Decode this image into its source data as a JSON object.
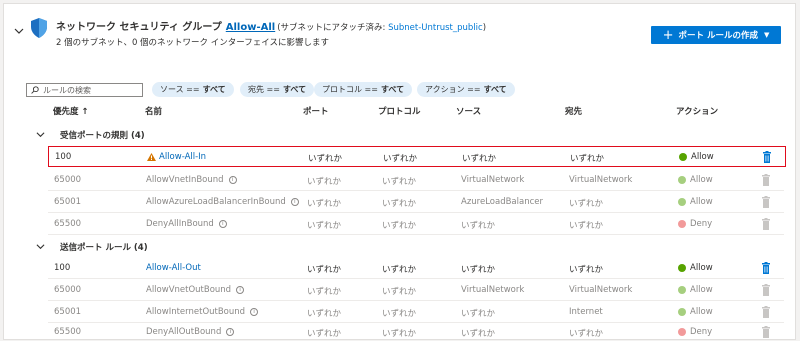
{
  "header": {
    "title": "ネットワーク セキュリティ グループ",
    "nsg_name": "Allow-All",
    "attached_prefix": "(サブネットにアタッチ済み: ",
    "attached_subnet": "Subnet-Untrust_public",
    "attached_suffix": ")",
    "subtitle": "2 個のサブネット、0 個のネットワーク インターフェイスに影響します",
    "create_button": "ポート ルールの作成"
  },
  "filters": {
    "search_placeholder": "ルールの検索",
    "pills": [
      {
        "label": "ソース ==",
        "value": "すべて"
      },
      {
        "label": "宛先 ==",
        "value": "すべて"
      },
      {
        "label": "プロトコル ==",
        "value": "すべて"
      },
      {
        "label": "アクション ==",
        "value": "すべて"
      }
    ]
  },
  "columns": {
    "priority": "優先度 ↑",
    "name": "名前",
    "port": "ポート",
    "protocol": "プロトコル",
    "source": "ソース",
    "destination": "宛先",
    "action": "アクション"
  },
  "groups": [
    {
      "label": "受信ポートの規則 (4)",
      "rows": [
        {
          "priority": "100",
          "name": "Allow-All-In",
          "port": "いずれか",
          "protocol": "いずれか",
          "source": "いずれか",
          "destination": "いずれか",
          "action": "Allow"
        },
        {
          "priority": "65000",
          "name": "AllowVnetInBound",
          "port": "いずれか",
          "protocol": "いずれか",
          "source": "VirtualNetwork",
          "destination": "VirtualNetwork",
          "action": "Allow"
        },
        {
          "priority": "65001",
          "name": "AllowAzureLoadBalancerInBound",
          "port": "いずれか",
          "protocol": "いずれか",
          "source": "AzureLoadBalancer",
          "destination": "いずれか",
          "action": "Allow"
        },
        {
          "priority": "65500",
          "name": "DenyAllInBound",
          "port": "いずれか",
          "protocol": "いずれか",
          "source": "いずれか",
          "destination": "いずれか",
          "action": "Deny"
        }
      ]
    },
    {
      "label": "送信ポート ルール (4)",
      "rows": [
        {
          "priority": "100",
          "name": "Allow-All-Out",
          "port": "いずれか",
          "protocol": "いずれか",
          "source": "いずれか",
          "destination": "いずれか",
          "action": "Allow"
        },
        {
          "priority": "65000",
          "name": "AllowVnetOutBound",
          "port": "いずれか",
          "protocol": "いずれか",
          "source": "VirtualNetwork",
          "destination": "VirtualNetwork",
          "action": "Allow"
        },
        {
          "priority": "65001",
          "name": "AllowInternetOutBound",
          "port": "いずれか",
          "protocol": "いずれか",
          "source": "いずれか",
          "destination": "Internet",
          "action": "Allow"
        },
        {
          "priority": "65500",
          "name": "DenyAllOutBound",
          "port": "いずれか",
          "protocol": "いずれか",
          "source": "いずれか",
          "destination": "いずれか",
          "action": "Deny"
        }
      ]
    }
  ],
  "colors": {
    "accent": "#0078d4",
    "allow": "#57a300",
    "deny": "#e81123",
    "highlight": "#e00b1c"
  }
}
